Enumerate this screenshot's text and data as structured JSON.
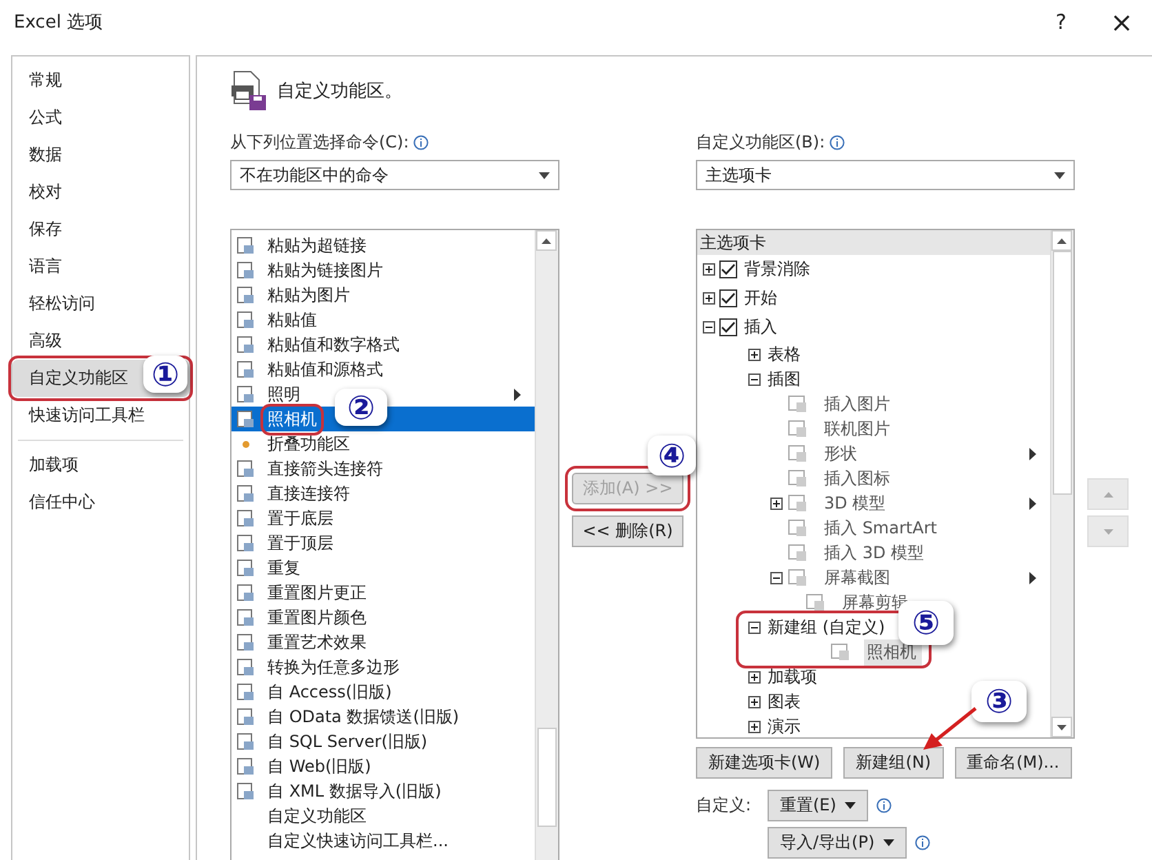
{
  "window": {
    "title": "Excel 选项",
    "help": "?",
    "close": "×"
  },
  "sidebar": {
    "items": [
      {
        "label": "常规",
        "selected": false
      },
      {
        "label": "公式",
        "selected": false
      },
      {
        "label": "数据",
        "selected": false
      },
      {
        "label": "校对",
        "selected": false
      },
      {
        "label": "保存",
        "selected": false
      },
      {
        "label": "语言",
        "selected": false
      },
      {
        "label": "轻松访问",
        "selected": false
      },
      {
        "label": "高级",
        "selected": false
      },
      {
        "label": "自定义功能区",
        "selected": true,
        "annotated": true
      },
      {
        "label": "快速访问工具栏",
        "selected": false
      }
    ],
    "extra_items": [
      {
        "label": "加载项",
        "selected": false
      },
      {
        "label": "信任中心",
        "selected": false
      }
    ]
  },
  "header": {
    "title": "自定义功能区。"
  },
  "commands": {
    "label": "从下列位置选择命令(C):",
    "dropdown": "不在功能区中的命令",
    "items": [
      {
        "label": "粘贴为超链接",
        "selected": false,
        "kind": "icon"
      },
      {
        "label": "粘贴为链接图片",
        "selected": false,
        "kind": "icon"
      },
      {
        "label": "粘贴为图片",
        "selected": false,
        "kind": "icon"
      },
      {
        "label": "粘贴值",
        "selected": false,
        "kind": "icon"
      },
      {
        "label": "粘贴值和数字格式",
        "selected": false,
        "kind": "icon"
      },
      {
        "label": "粘贴值和源格式",
        "selected": false,
        "kind": "icon"
      },
      {
        "label": "照明",
        "selected": false,
        "kind": "submenu"
      },
      {
        "label": "照相机",
        "selected": true,
        "kind": "icon",
        "annotated": true
      },
      {
        "label": "折叠功能区",
        "selected": false,
        "kind": "dot"
      },
      {
        "label": "直接箭头连接符",
        "selected": false,
        "kind": "icon"
      },
      {
        "label": "直接连接符",
        "selected": false,
        "kind": "icon"
      },
      {
        "label": "置于底层",
        "selected": false,
        "kind": "icon"
      },
      {
        "label": "置于顶层",
        "selected": false,
        "kind": "icon"
      },
      {
        "label": "重复",
        "selected": false,
        "kind": "icon"
      },
      {
        "label": "重置图片更正",
        "selected": false,
        "kind": "icon"
      },
      {
        "label": "重置图片颜色",
        "selected": false,
        "kind": "icon"
      },
      {
        "label": "重置艺术效果",
        "selected": false,
        "kind": "icon"
      },
      {
        "label": "转换为任意多边形",
        "selected": false,
        "kind": "icon"
      },
      {
        "label": "自 Access(旧版)",
        "selected": false,
        "kind": "icon"
      },
      {
        "label": "自 OData 数据馈送(旧版)",
        "selected": false,
        "kind": "icon"
      },
      {
        "label": "自 SQL Server(旧版)",
        "selected": false,
        "kind": "icon"
      },
      {
        "label": "自 Web(旧版)",
        "selected": false,
        "kind": "icon"
      },
      {
        "label": "自 XML 数据导入(旧版)",
        "selected": false,
        "kind": "icon"
      },
      {
        "label": "自定义功能区",
        "selected": false,
        "kind": "plain"
      },
      {
        "label": "自定义快速访问工具栏...",
        "selected": false,
        "kind": "plain"
      }
    ]
  },
  "transfer": {
    "add": {
      "label": "添加(A) >>",
      "disabled": true,
      "annotated": true
    },
    "remove": {
      "label": "<< 删除(R)",
      "disabled": false
    }
  },
  "ribbon": {
    "label": "自定义功能区(B):",
    "dropdown": "主选项卡",
    "header": "主选项卡",
    "tree": [
      {
        "label": "背景消除",
        "expanded": false,
        "checked": true,
        "selected": false
      },
      {
        "label": "开始",
        "expanded": false,
        "checked": true,
        "selected": false
      },
      {
        "label": "插入",
        "expanded": true,
        "checked": true,
        "selected": false,
        "children": [
          {
            "label": "表格",
            "expanded": false,
            "selected": false
          },
          {
            "label": "插图",
            "expanded": true,
            "selected": false,
            "children": [
              {
                "label": "插入图片",
                "selected": false
              },
              {
                "label": "联机图片",
                "selected": false
              },
              {
                "label": "形状",
                "selected": false,
                "submenu": true
              },
              {
                "label": "插入图标",
                "selected": false
              },
              {
                "label": "3D 模型",
                "expanded": false,
                "selected": false,
                "submenu": true
              },
              {
                "label": "插入 SmartArt",
                "selected": false
              },
              {
                "label": "插入 3D 模型",
                "selected": false
              },
              {
                "label": "屏幕截图",
                "expanded": true,
                "selected": false,
                "submenu": true,
                "children": [
                  {
                    "label": "屏幕剪辑",
                    "selected": false
                  }
                ]
              }
            ]
          },
          {
            "label": "新建组 (自定义)",
            "expanded": true,
            "selected": false,
            "annotated": true,
            "children": [
              {
                "label": "照相机",
                "selected": true
              }
            ]
          },
          {
            "label": "加载项",
            "expanded": false,
            "selected": false
          },
          {
            "label": "图表",
            "expanded": false,
            "selected": false
          },
          {
            "label": "演示",
            "expanded": false,
            "selected": false
          }
        ]
      }
    ],
    "buttons": [
      "新建选项卡(W)",
      "新建组(N)",
      "重命名(M)..."
    ],
    "customize_label": "自定义:",
    "reset": "重置(E)",
    "import_export": "导入/导出(P)"
  },
  "annotations": [
    "①",
    "②",
    "④",
    "⑤",
    "③"
  ]
}
